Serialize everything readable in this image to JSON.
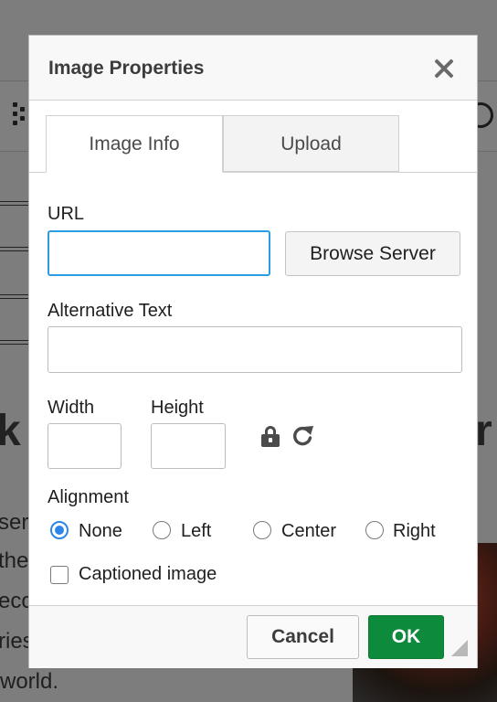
{
  "background": {
    "big_left": "k",
    "big_right": "r",
    "text_lines": [
      "ser",
      "the",
      "eco",
      "ries",
      "world."
    ]
  },
  "dialog": {
    "title": "Image Properties",
    "close_icon": "close-icon",
    "tabs": [
      {
        "label": "Image Info",
        "active": true
      },
      {
        "label": "Upload",
        "active": false
      }
    ],
    "url": {
      "label": "URL",
      "value": "",
      "placeholder": ""
    },
    "browse_label": "Browse Server",
    "alt_text": {
      "label": "Alternative Text",
      "value": ""
    },
    "width": {
      "label": "Width",
      "value": ""
    },
    "height": {
      "label": "Height",
      "value": ""
    },
    "lock_icon": "lock-icon",
    "reset_icon": "reset-size-icon",
    "alignment": {
      "label": "Alignment",
      "options": [
        "None",
        "Left",
        "Center",
        "Right"
      ],
      "selected": "None"
    },
    "captioned": {
      "label": "Captioned image",
      "checked": false
    },
    "cancel_label": "Cancel",
    "ok_label": "OK"
  },
  "colors": {
    "accent_focus": "#2c9ce3",
    "radio_selected": "#2c86e8",
    "ok_button": "#0e8a3c"
  }
}
